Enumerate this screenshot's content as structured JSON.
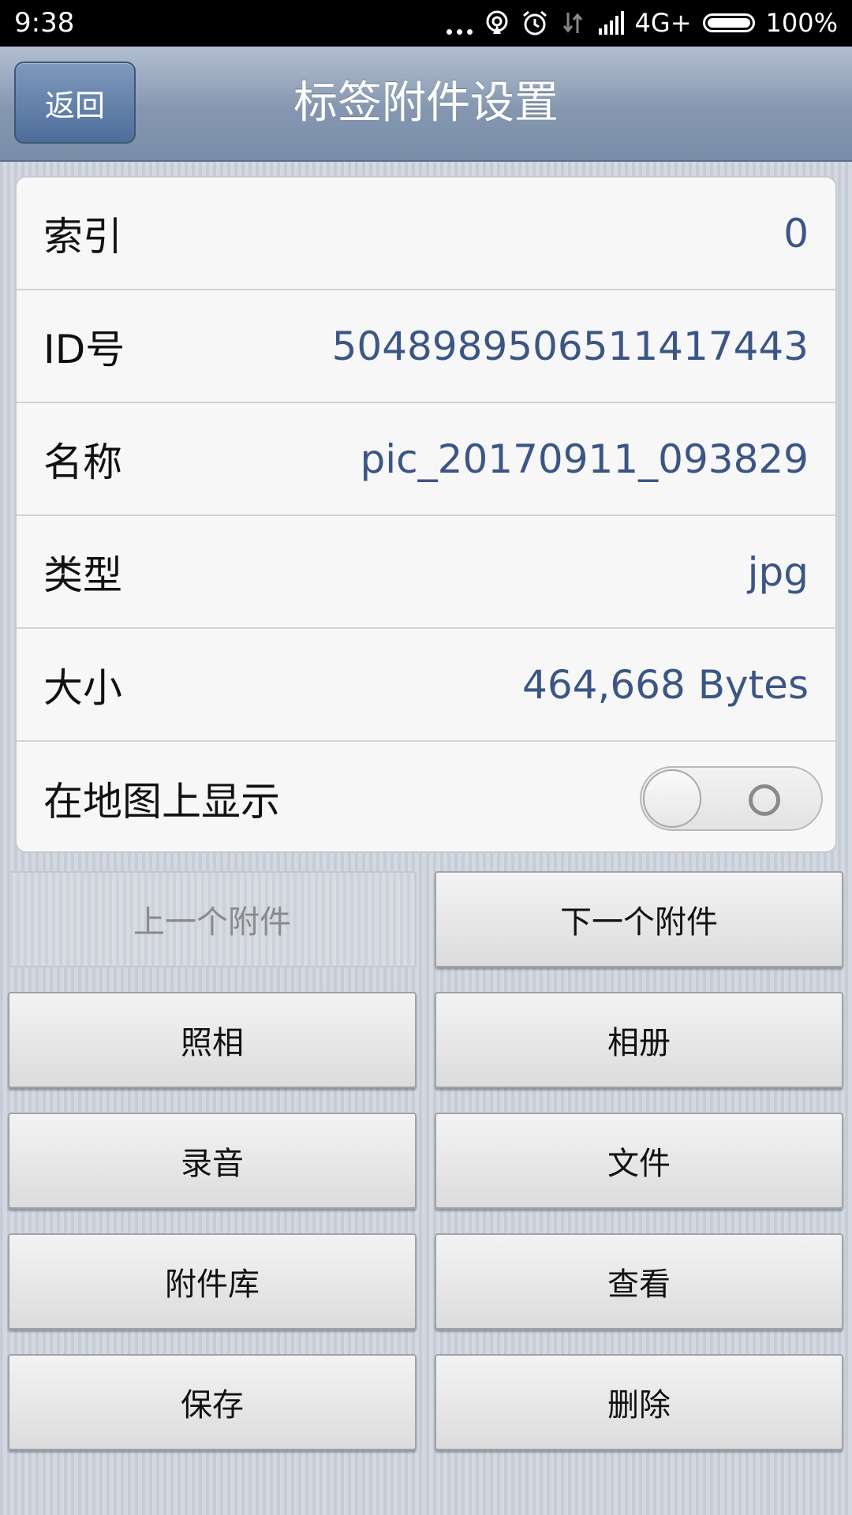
{
  "status_bar": {
    "time": "9:38",
    "network": "4G+",
    "battery": "100%",
    "icons": [
      "more-dots-icon",
      "hotspot-icon",
      "alarm-icon",
      "data-arrows-icon",
      "signal-icon",
      "battery-icon"
    ]
  },
  "header": {
    "back_label": "返回",
    "title": "标签附件设置"
  },
  "info": {
    "rows": [
      {
        "label": "索引",
        "value": "0"
      },
      {
        "label": "ID号",
        "value": "5048989506511417443"
      },
      {
        "label": "名称",
        "value": "pic_20170911_093829"
      },
      {
        "label": "类型",
        "value": "jpg"
      },
      {
        "label": "大小",
        "value": "464,668 Bytes"
      }
    ],
    "map_toggle": {
      "label": "在地图上显示",
      "state": "off"
    }
  },
  "buttons": {
    "prev": "上一个附件",
    "next": "下一个附件",
    "camera": "照相",
    "album": "相册",
    "record": "录音",
    "file": "文件",
    "library": "附件库",
    "view": "查看",
    "save": "保存",
    "delete": "删除"
  },
  "colors": {
    "value_text": "#3b5585",
    "title_bar": "#8597b0",
    "back_button": "#4d6d9a"
  }
}
